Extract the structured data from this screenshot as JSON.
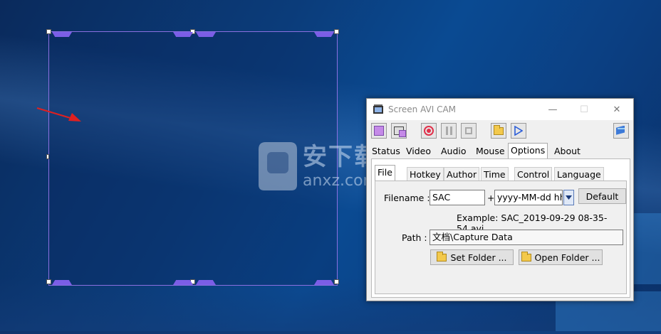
{
  "app": {
    "title": "Screen AVI CAM",
    "minimize": "—",
    "maximize": "☐",
    "close": "✕"
  },
  "toolbar": {
    "buttons": [
      "region-icon",
      "window-icon",
      "record-icon",
      "pause-icon",
      "stop-icon",
      "folder-icon",
      "play-icon",
      "help-book-icon"
    ]
  },
  "tabs": [
    "Status",
    "Video",
    "Audio",
    "Mouse",
    "Options",
    "About"
  ],
  "active_tab": "Options",
  "subtabs": [
    "File",
    "Hotkey",
    "Author",
    "Time",
    "Control",
    "Language"
  ],
  "active_subtab": "File",
  "file": {
    "filename_label": "Filename :",
    "filename_value": "SAC",
    "plus": "+",
    "date_format": "yyyy-MM-dd hh",
    "default_button": "Default",
    "example": "Example: SAC_2019-09-29 08-35-54.avi",
    "path_label": "Path :",
    "path_value": "文档\\Capture Data",
    "set_folder": "Set Folder ...",
    "open_folder": "Open Folder ..."
  },
  "watermark": {
    "big": "安下载",
    "small": "anxz.com"
  },
  "colors": {
    "region_border": "#8b6fe0",
    "region_marks": "#7b5ee6",
    "arrow": "#e02020"
  }
}
